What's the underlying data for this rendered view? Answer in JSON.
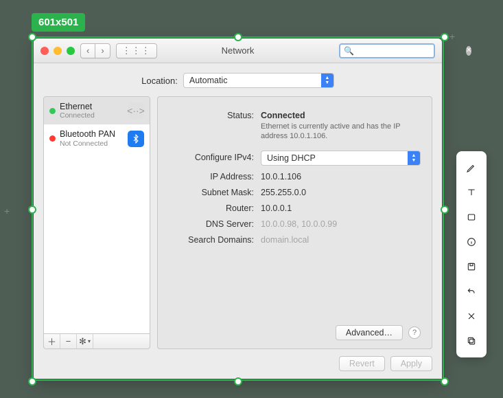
{
  "editor": {
    "dimensions_label": "601x501",
    "tools": [
      "pen",
      "text",
      "rect",
      "info",
      "save",
      "undo",
      "close",
      "copy"
    ]
  },
  "window": {
    "title": "Network",
    "search_placeholder": "",
    "nav_back_glyph": "‹",
    "nav_fwd_glyph": "›",
    "grid_glyph": "⋮⋮⋮"
  },
  "location": {
    "label": "Location:",
    "value": "Automatic"
  },
  "sidebar": {
    "items": [
      {
        "name": "Ethernet",
        "status": "Connected",
        "dot": "g",
        "icon": "eth",
        "glyph": "<··>",
        "selected": true
      },
      {
        "name": "Bluetooth PAN",
        "status": "Not Connected",
        "dot": "r",
        "icon": "bt",
        "glyph": "⎌",
        "selected": false
      }
    ],
    "add_glyph": "＋",
    "remove_glyph": "−",
    "action_glyph": "✻"
  },
  "detail": {
    "status_label": "Status:",
    "status_value": "Connected",
    "status_desc": "Ethernet is currently active and has the IP address 10.0.1.106.",
    "configure_label": "Configure IPv4:",
    "configure_value": "Using DHCP",
    "ip_label": "IP Address:",
    "ip_value": "10.0.1.106",
    "mask_label": "Subnet Mask:",
    "mask_value": "255.255.0.0",
    "router_label": "Router:",
    "router_value": "10.0.0.1",
    "dns_label": "DNS Server:",
    "dns_value": "10.0.0.98, 10.0.0.99",
    "search_label": "Search Domains:",
    "search_value": "domain.local",
    "advanced_label": "Advanced…",
    "help_glyph": "?"
  },
  "footer": {
    "revert_label": "Revert",
    "apply_label": "Apply"
  }
}
